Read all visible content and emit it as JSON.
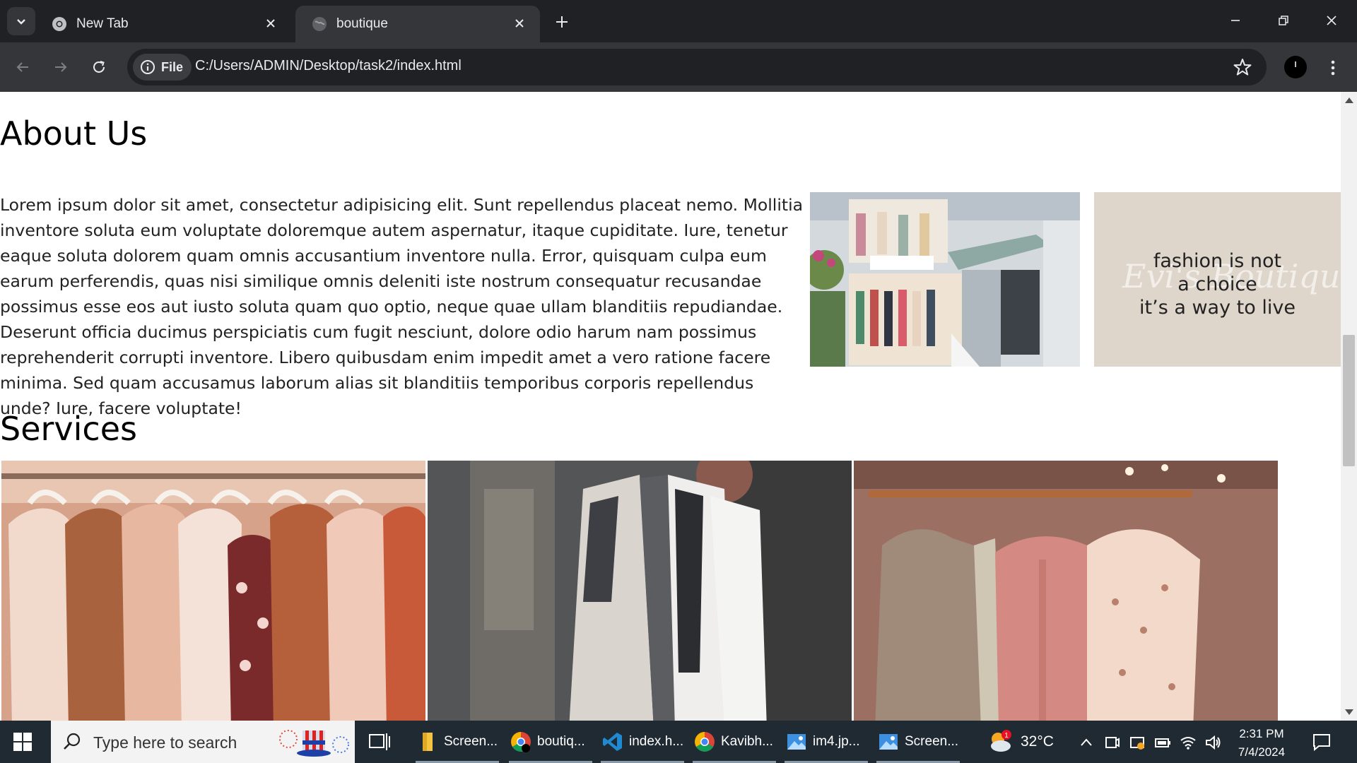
{
  "browser": {
    "tabs": [
      {
        "title": "New Tab"
      },
      {
        "title": "boutique"
      }
    ],
    "site_chip": "File",
    "url": "C:/Users/ADMIN/Desktop/task2/index.html"
  },
  "page": {
    "about_heading": "About Us",
    "about_text": "Lorem ipsum dolor sit amet, consectetur adipisicing elit. Sunt repellendus placeat nemo. Mollitia inventore soluta eum voluptate doloremque autem aspernatur, itaque cupiditate. Iure, tenetur eaque soluta dolorem quam omnis accusantium inventore nulla. Error, quisquam culpa eum earum perferendis, quas nisi similique omnis deleniti iste nostrum consequatur recusandae possimus esse eos aut iusto soluta quam quo optio, neque quae ullam blanditiis repudiandae. Deserunt officia ducimus perspiciatis cum fugit nesciunt, dolore odio harum nam possimus reprehenderit corrupti inventore. Libero quibusdam enim impedit amet a vero ratione facere minima. Sed quam accusamus laborum alias sit blanditiis temporibus corporis repellendus unde? Iure, facere voluptate!",
    "quote_lines": [
      "fashion is not",
      "a choice",
      "it’s a way to live"
    ],
    "quote_watermark": "Evi's Boutique",
    "services_heading": "Services"
  },
  "taskbar": {
    "search_placeholder": "Type here to search",
    "apps": [
      {
        "label": "Screen...",
        "icon": "file-explorer-icon"
      },
      {
        "label": "boutiq...",
        "icon": "chrome-icon"
      },
      {
        "label": "index.h...",
        "icon": "vscode-icon"
      },
      {
        "label": "Kavibh...",
        "icon": "chrome-icon"
      },
      {
        "label": "im4.jp...",
        "icon": "photos-icon"
      },
      {
        "label": "Screen...",
        "icon": "photos-icon"
      }
    ],
    "weather_temp": "32°C",
    "weather_badge": "1",
    "time": "2:31 PM",
    "date": "7/4/2024"
  },
  "colors": {
    "chrome_dark": "#202124",
    "chrome_toolbar": "#35363a",
    "taskbar": "#1f2a33",
    "quote_card_bg": "#ded5cb"
  }
}
